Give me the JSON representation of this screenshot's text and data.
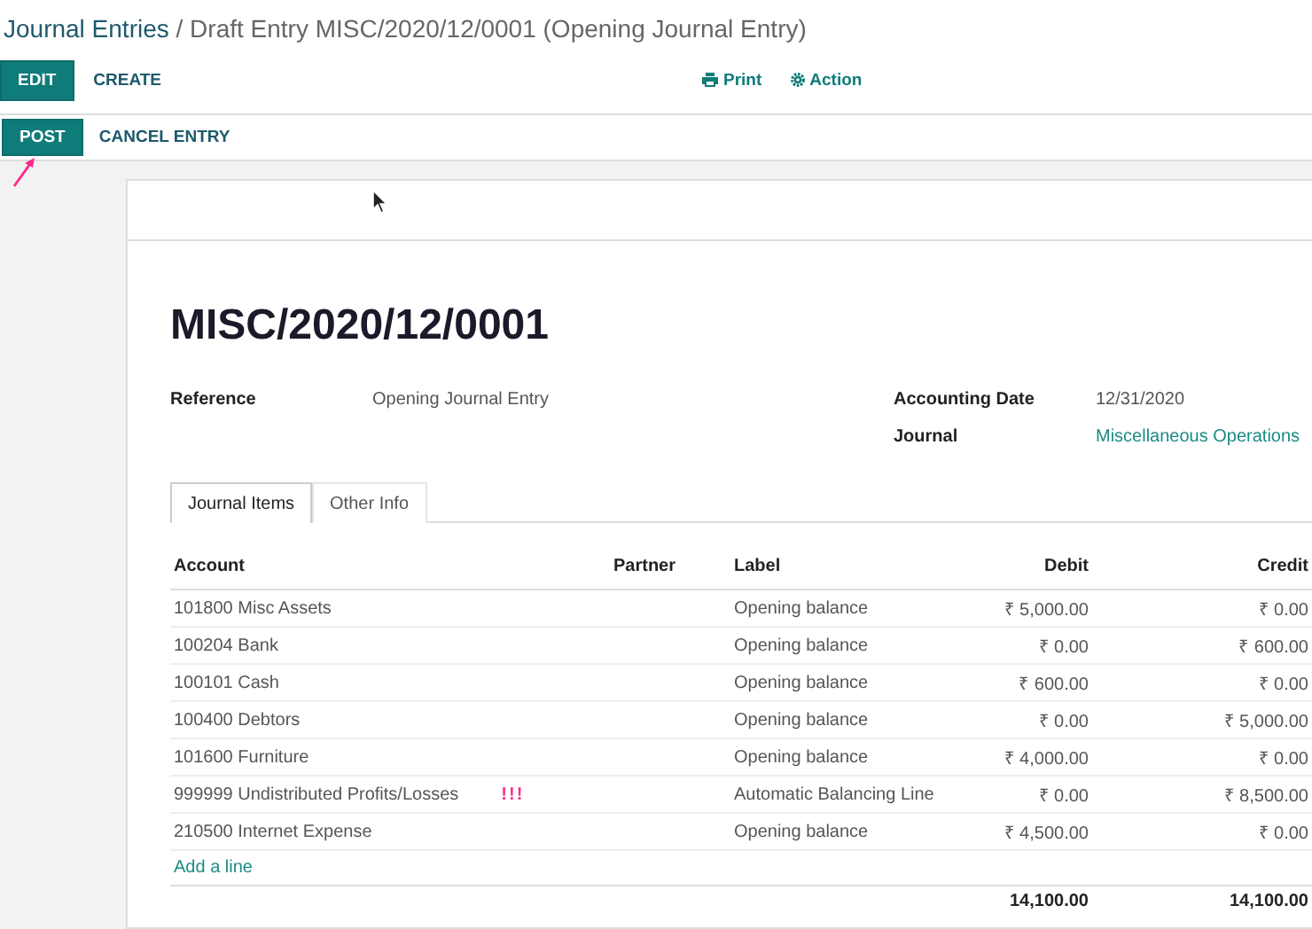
{
  "breadcrumb": {
    "parent": "Journal Entries",
    "current": "/ Draft Entry MISC/2020/12/0001 (Opening Journal Entry)"
  },
  "toolbar": {
    "buttons": [
      {
        "label": "EDIT",
        "kind": "primary"
      },
      {
        "label": "CREATE",
        "kind": "link"
      }
    ],
    "actions": [
      {
        "label": "Print",
        "kind": "print"
      },
      {
        "label": "Action",
        "kind": "gear"
      }
    ]
  },
  "statusbar": {
    "buttons": [
      {
        "label": "POST",
        "kind": "primary"
      },
      {
        "label": "CANCEL ENTRY",
        "kind": "link"
      }
    ]
  },
  "form": {
    "title": "MISC/2020/12/0001",
    "left_fields": [
      {
        "label": "Reference",
        "value": "Opening Journal Entry",
        "kind": "text"
      }
    ],
    "right_fields": [
      {
        "label": "Accounting Date",
        "value": "12/31/2020",
        "kind": "text"
      },
      {
        "label": "Journal",
        "value": "Miscellaneous Operations",
        "kind": "link"
      }
    ],
    "tabs": [
      {
        "label": "Journal Items",
        "selected": true
      },
      {
        "label": "Other Info",
        "selected": false
      }
    ],
    "table": {
      "columns": [
        "Account",
        "Partner",
        "Label",
        "Debit",
        "Credit"
      ],
      "rows": [
        {
          "account": "101800 Misc Assets",
          "label": "Opening balance",
          "debit": "₹ 5,000.00",
          "credit": "₹ 0.00"
        },
        {
          "account": "100204 Bank",
          "label": "Opening balance",
          "debit": "₹ 0.00",
          "credit": "₹ 600.00"
        },
        {
          "account": "100101 Cash",
          "label": "Opening balance",
          "debit": "₹ 600.00",
          "credit": "₹ 0.00"
        },
        {
          "account": "100400 Debtors",
          "label": "Opening balance",
          "debit": "₹ 0.00",
          "credit": "₹ 5,000.00"
        },
        {
          "account": "101600 Furniture",
          "label": "Opening balance",
          "debit": "₹ 4,000.00",
          "credit": "₹ 0.00"
        },
        {
          "account": "999999 Undistributed Profits/Losses",
          "annotation": "!!!",
          "label": "Automatic Balancing Line",
          "debit": "₹ 0.00",
          "credit": "₹ 8,500.00"
        },
        {
          "account": "210500 Internet Expense",
          "label": "Opening balance",
          "debit": "₹ 4,500.00",
          "credit": "₹ 0.00"
        }
      ],
      "add_line": "Add a line",
      "totals": {
        "debit": "14,100.00",
        "credit": "14,100.00"
      }
    }
  }
}
